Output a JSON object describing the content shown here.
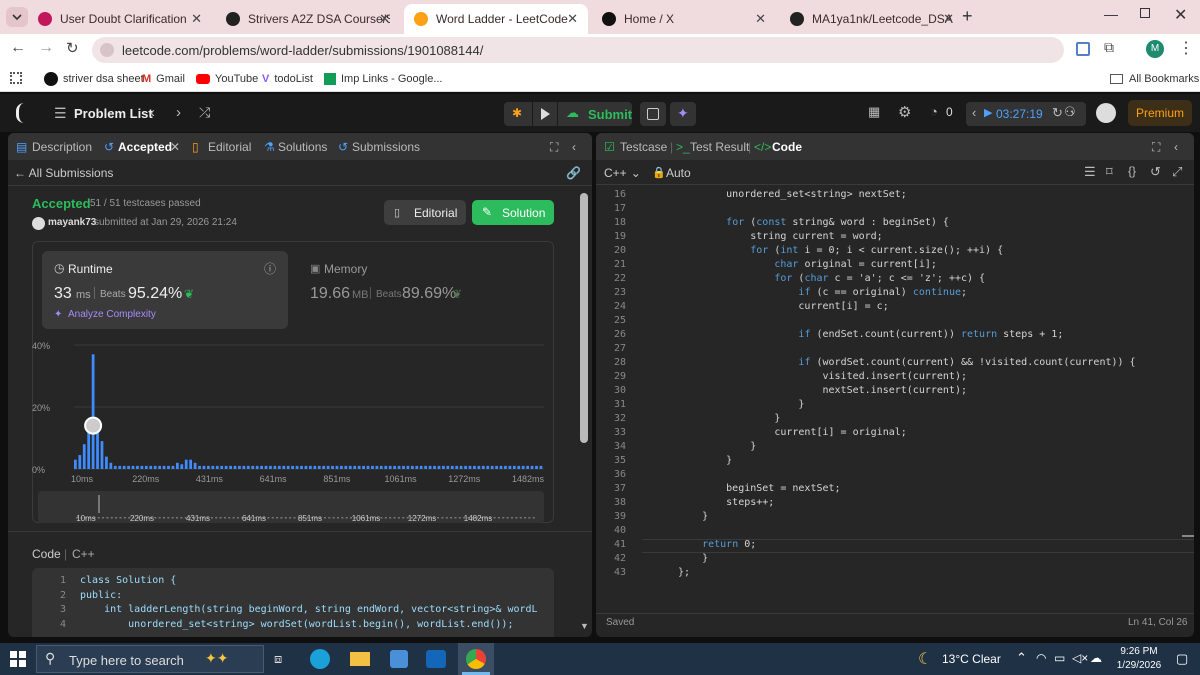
{
  "browser": {
    "tabs": [
      {
        "title": "User Doubt Clarification",
        "fav_color": "#c2185b"
      },
      {
        "title": "Strivers A2Z DSA Course/Sheet",
        "fav_color": "#222222"
      },
      {
        "title": "Word Ladder - LeetCode",
        "fav_color": "#ffa116",
        "active": true
      },
      {
        "title": "Home / X",
        "fav_color": "#111111"
      },
      {
        "title": "MA1ya1nk/Leetcode_DSA",
        "fav_color": "#222222"
      }
    ],
    "url": "leetcode.com/problems/word-ladder/submissions/1901088144/",
    "profile_initial": "M",
    "bookmarks": [
      "striver dsa sheet",
      "Gmail",
      "YouTube",
      "todoList",
      "Imp Links - Google..."
    ],
    "all_bookmarks": "All Bookmarks"
  },
  "lc": {
    "problem_list": "Problem List",
    "submit": "Submit",
    "streak": "0",
    "timer": "03:27:19",
    "premium": "Premium"
  },
  "left": {
    "tabs": [
      "Description",
      "Accepted",
      "Editorial",
      "Solutions",
      "Submissions"
    ],
    "back": "All Submissions",
    "status": "Accepted",
    "testcases": "51 / 51 testcases passed",
    "user": "mayank73",
    "submitted": "submitted at Jan 29, 2026 21:24",
    "editorial_btn": "Editorial",
    "solution_btn": "Solution",
    "runtime": {
      "label": "Runtime",
      "value": "33",
      "unit": "ms",
      "beats_label": "Beats",
      "beats": "95.24%"
    },
    "memory": {
      "label": "Memory",
      "value": "19.66",
      "unit": "MB",
      "beats_label": "Beats",
      "beats": "89.69%"
    },
    "analyze": "Analyze Complexity",
    "code_label": "Code",
    "lang": "C++",
    "code_lines": [
      {
        "n": "1",
        "t": "class Solution {"
      },
      {
        "n": "2",
        "t": "public:"
      },
      {
        "n": "3",
        "t": "    int ladderLength(string beginWord, string endWord, vector<string>& wordL"
      },
      {
        "n": "4",
        "t": "        unordered_set<string> wordSet(wordList.begin(), wordList.end());"
      }
    ]
  },
  "chart_data": {
    "type": "bar",
    "ylabel_ticks": [
      "40%",
      "20%",
      "0%"
    ],
    "ylim": [
      0,
      40
    ],
    "x_ticks": [
      "10ms",
      "220ms",
      "431ms",
      "641ms",
      "851ms",
      "1061ms",
      "1272ms",
      "1482ms"
    ],
    "values": [
      3,
      4.5,
      8,
      12,
      37,
      12,
      9,
      4,
      2,
      1,
      1,
      1,
      1,
      1,
      1,
      1,
      1,
      1,
      1,
      1,
      1,
      1,
      1,
      2,
      1.5,
      3,
      3,
      2,
      1,
      1,
      1,
      1,
      1,
      1,
      1,
      1,
      1,
      1,
      1,
      1,
      1,
      1,
      1,
      1,
      1,
      1,
      1,
      1,
      1,
      1,
      1,
      1,
      1,
      1,
      1,
      1,
      1,
      1,
      1,
      1,
      1,
      1,
      1,
      1,
      1,
      1,
      1,
      1,
      1,
      1,
      1,
      1,
      1,
      1,
      1,
      1,
      1,
      1,
      1,
      1,
      1,
      1,
      1,
      1,
      1,
      1,
      1,
      1,
      1,
      1,
      1,
      1,
      1,
      1,
      1,
      1,
      1,
      1,
      1,
      1,
      1,
      1,
      1,
      1,
      1,
      1
    ],
    "highlight_index": 4,
    "marker_value": 14
  },
  "right": {
    "tabs": [
      "Testcase",
      "Test Result",
      "Code"
    ],
    "lang": "C++",
    "auto": "Auto",
    "saved": "Saved",
    "cursor": "Ln 41, Col 26",
    "code_lines": [
      {
        "n": "16",
        "t": "        unordered_set<string> nextSet;"
      },
      {
        "n": "17",
        "t": ""
      },
      {
        "n": "18",
        "t": "        for (const string& word : beginSet) {"
      },
      {
        "n": "19",
        "t": "            string current = word;"
      },
      {
        "n": "20",
        "t": "            for (int i = 0; i < current.size(); ++i) {"
      },
      {
        "n": "21",
        "t": "                char original = current[i];"
      },
      {
        "n": "22",
        "t": "                for (char c = 'a'; c <= 'z'; ++c) {"
      },
      {
        "n": "23",
        "t": "                    if (c == original) continue;"
      },
      {
        "n": "24",
        "t": "                    current[i] = c;"
      },
      {
        "n": "25",
        "t": ""
      },
      {
        "n": "26",
        "t": "                    if (endSet.count(current)) return steps + 1;"
      },
      {
        "n": "27",
        "t": ""
      },
      {
        "n": "28",
        "t": "                    if (wordSet.count(current) && !visited.count(current)) {"
      },
      {
        "n": "29",
        "t": "                        visited.insert(current);"
      },
      {
        "n": "30",
        "t": "                        nextSet.insert(current);"
      },
      {
        "n": "31",
        "t": "                    }"
      },
      {
        "n": "32",
        "t": "                }"
      },
      {
        "n": "33",
        "t": "                current[i] = original;"
      },
      {
        "n": "34",
        "t": "            }"
      },
      {
        "n": "35",
        "t": "        }"
      },
      {
        "n": "36",
        "t": ""
      },
      {
        "n": "37",
        "t": "        beginSet = nextSet;"
      },
      {
        "n": "38",
        "t": "        steps++;"
      },
      {
        "n": "39",
        "t": "    }"
      },
      {
        "n": "40",
        "t": ""
      },
      {
        "n": "41",
        "t": "    return 0;"
      },
      {
        "n": "42",
        "t": "    }"
      },
      {
        "n": "43",
        "t": "};"
      }
    ]
  },
  "taskbar": {
    "search": "Type here to search",
    "weather": "13°C  Clear",
    "time": "9:26 PM",
    "date": "1/29/2026"
  }
}
